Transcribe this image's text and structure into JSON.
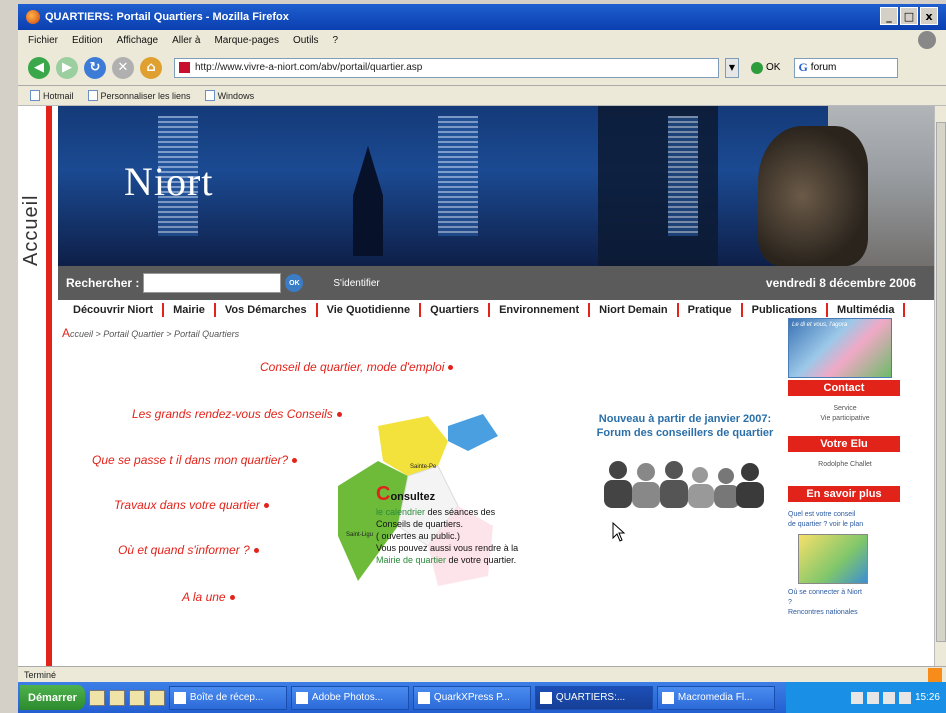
{
  "window": {
    "title": "QUARTIERS: Portail Quartiers - Mozilla Firefox",
    "buttons": [
      "_",
      "□",
      "x"
    ]
  },
  "menu": [
    "Fichier",
    "Edition",
    "Affichage",
    "Aller à",
    "Marque-pages",
    "Outils",
    "?"
  ],
  "nav": {
    "url": "http://www.vivre-a-niort.com/abv/portail/quartier.asp",
    "go_label": "OK",
    "search_value": "forum",
    "search_engine_glyph": "G"
  },
  "bookmarks": [
    "Hotmail",
    "Personnaliser les liens",
    "Windows"
  ],
  "page": {
    "sidebar_label": "Accueil",
    "banner_logo": "Niort",
    "search": {
      "label": "Rechercher :",
      "ok": "OK",
      "login": "S'identifier"
    },
    "date": "vendredi 8 décembre 2006",
    "topnav": [
      "Découvrir Niort",
      "Mairie",
      "Vos Démarches",
      "Vie Quotidienne",
      "Quartiers",
      "Environnement",
      "Niort Demain",
      "Pratique",
      "Publications",
      "Multimédia"
    ],
    "breadcrumb": {
      "first_letter": "A",
      "rest": "ccueil > Portail Quartier > Portail Quartiers"
    },
    "links": {
      "conseil": "Conseil de quartier, mode d'emploi",
      "rdv": "Les grands rendez-vous des Conseils",
      "que_se_passe": "Que se passe t il dans mon quartier?",
      "travaux": "Travaux dans votre quartier",
      "ou_quand": "Où et quand s'informer ?",
      "a_la_une": "A la une"
    },
    "map_labels": {
      "saint_liguaire": "Saint-Ligu",
      "sainte_pezenne": "Sainte-Pe"
    },
    "consultez": {
      "first": "C",
      "rest": "onsultez",
      "line1_hl": "le calendrier",
      "line1_rest": " des séances des",
      "line2": "Conseils de quartiers.",
      "line3": "( ouvertes au public.)",
      "line4": "Vous pouvez aussi vous rendre à la",
      "line5_hl": "Mairie de quartier",
      "line5_rest": " de votre quartier."
    },
    "forum": {
      "line1": "Nouveau à partir de janvier 2007:",
      "line2": "Forum des conseillers de quartier"
    },
    "right": {
      "thumb_caption": "Le di et vous, l'agora",
      "contact": "Contact",
      "contact_sub1": "Service",
      "contact_sub2": "Vie participative",
      "elu": "Votre Elu",
      "elu_name": "Rodolphe Challet",
      "savoir": "En savoir plus",
      "link1": "Quel est votre conseil",
      "link2": "de quartier ? voir le plan",
      "link3": "Où se connecter à Niort",
      "link3b": "?",
      "link4": "Rencontres nationales"
    }
  },
  "status": "Terminé",
  "taskbar": {
    "start": "Démarrer",
    "tasks": [
      "Boîte de récep...",
      "Adobe Photos...",
      "QuarkXPress P...",
      "QUARTIERS:...",
      "Macromedia Fl..."
    ],
    "clock": "15:26"
  },
  "colors": {
    "accent_red": "#e2231a",
    "nav_gray": "#5b5b5b",
    "forum_blue": "#2b6fa8"
  }
}
